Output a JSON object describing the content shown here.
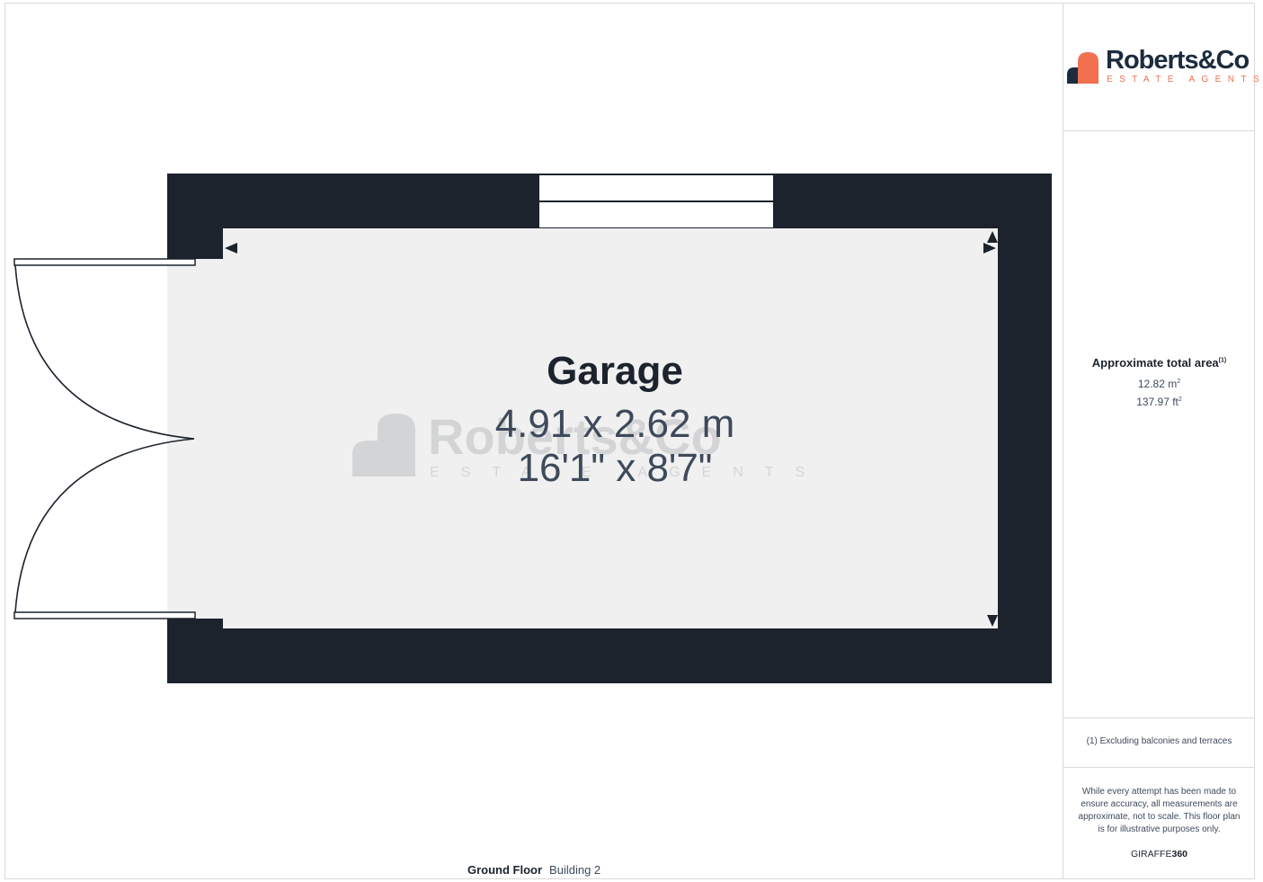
{
  "room": {
    "name": "Garage",
    "dimensions_metric": "4.91 x 2.62 m",
    "dimensions_imperial": "16'1\" x 8'7\""
  },
  "watermark": {
    "brand": "Roberts&Co",
    "tagline": "ESTATE AGENTS"
  },
  "logo": {
    "brand": "Roberts&Co",
    "tagline": "ESTATE AGENTS",
    "colors": {
      "mark_orange": "#f07050",
      "mark_navy": "#1c2b3f",
      "text": "#1c2b3f"
    }
  },
  "area": {
    "title": "Approximate total area",
    "footnote_marker": "(1)",
    "metric_value": "12.82 m",
    "metric_unit_sup": "2",
    "imperial_value": "137.97 ft",
    "imperial_unit_sup": "2"
  },
  "footnote": "(1) Excluding balconies and terraces",
  "disclaimer": "While every attempt has been made to ensure accuracy, all measurements are approximate, not to scale. This floor plan is for illustrative purposes only.",
  "maker": {
    "prefix": "GIRAFFE",
    "suffix": "360"
  },
  "floor": {
    "label": "Ground Floor",
    "building": "Building 2"
  },
  "colors": {
    "wall": "#1c232d",
    "floor_fill": "#f0f0f0",
    "text_dark": "#1c232d",
    "text_mid": "#3e4a5a"
  }
}
